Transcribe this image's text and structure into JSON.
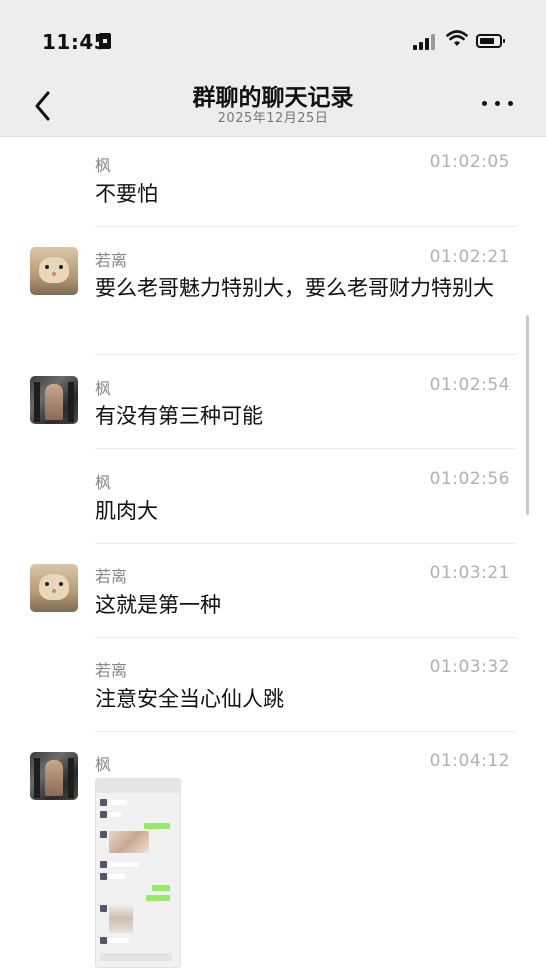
{
  "status_bar": {
    "time": "11:45",
    "icons": [
      "lock-icon",
      "signal-icon",
      "wifi-icon",
      "battery-icon"
    ]
  },
  "nav": {
    "title": "群聊的聊天记录",
    "subtitle": "2025年12月25日",
    "back_icon": "chevron-left-icon",
    "more_icon": "more-icon"
  },
  "messages": [
    {
      "sender": "枫",
      "time": "01:02:05",
      "text": "不要怕",
      "avatar": "none"
    },
    {
      "sender": "若离",
      "time": "01:02:21",
      "text": "要么老哥魅力特别大，要么老哥财力特别大",
      "avatar": "rabbit"
    },
    {
      "sender": "枫",
      "time": "01:02:54",
      "text": "有没有第三种可能",
      "avatar": "gym"
    },
    {
      "sender": "枫",
      "time": "01:02:56",
      "text": "肌肉大",
      "avatar": "none"
    },
    {
      "sender": "若离",
      "time": "01:03:21",
      "text": "这就是第一种",
      "avatar": "rabbit"
    },
    {
      "sender": "若离",
      "time": "01:03:32",
      "text": "注意安全当心仙人跳",
      "avatar": "none"
    },
    {
      "sender": "枫",
      "time": "01:04:12",
      "text": "",
      "avatar": "gym",
      "attachment": "screenshot-image"
    }
  ],
  "colors": {
    "nav_bg": "#ededed",
    "time_text": "#b0b0b0",
    "sender_text": "#888888",
    "divider": "#ececec"
  }
}
